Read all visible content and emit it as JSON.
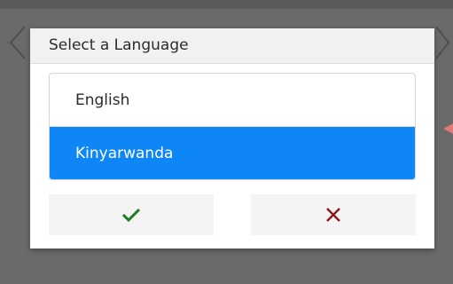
{
  "dialog": {
    "title": "Select a Language"
  },
  "languages": [
    {
      "label": "English",
      "selected": false
    },
    {
      "label": "Kinyarwanda",
      "selected": true
    }
  ],
  "actions": {
    "confirm_icon": "check-icon",
    "cancel_icon": "close-icon"
  },
  "colors": {
    "selected_background": "#0f86f5",
    "selected_text": "#ffffff",
    "confirm_icon": "#1e7a1e",
    "cancel_icon": "#8b1a1a",
    "overlay": "#6a6a6a",
    "background_arrow": "#e07878"
  }
}
